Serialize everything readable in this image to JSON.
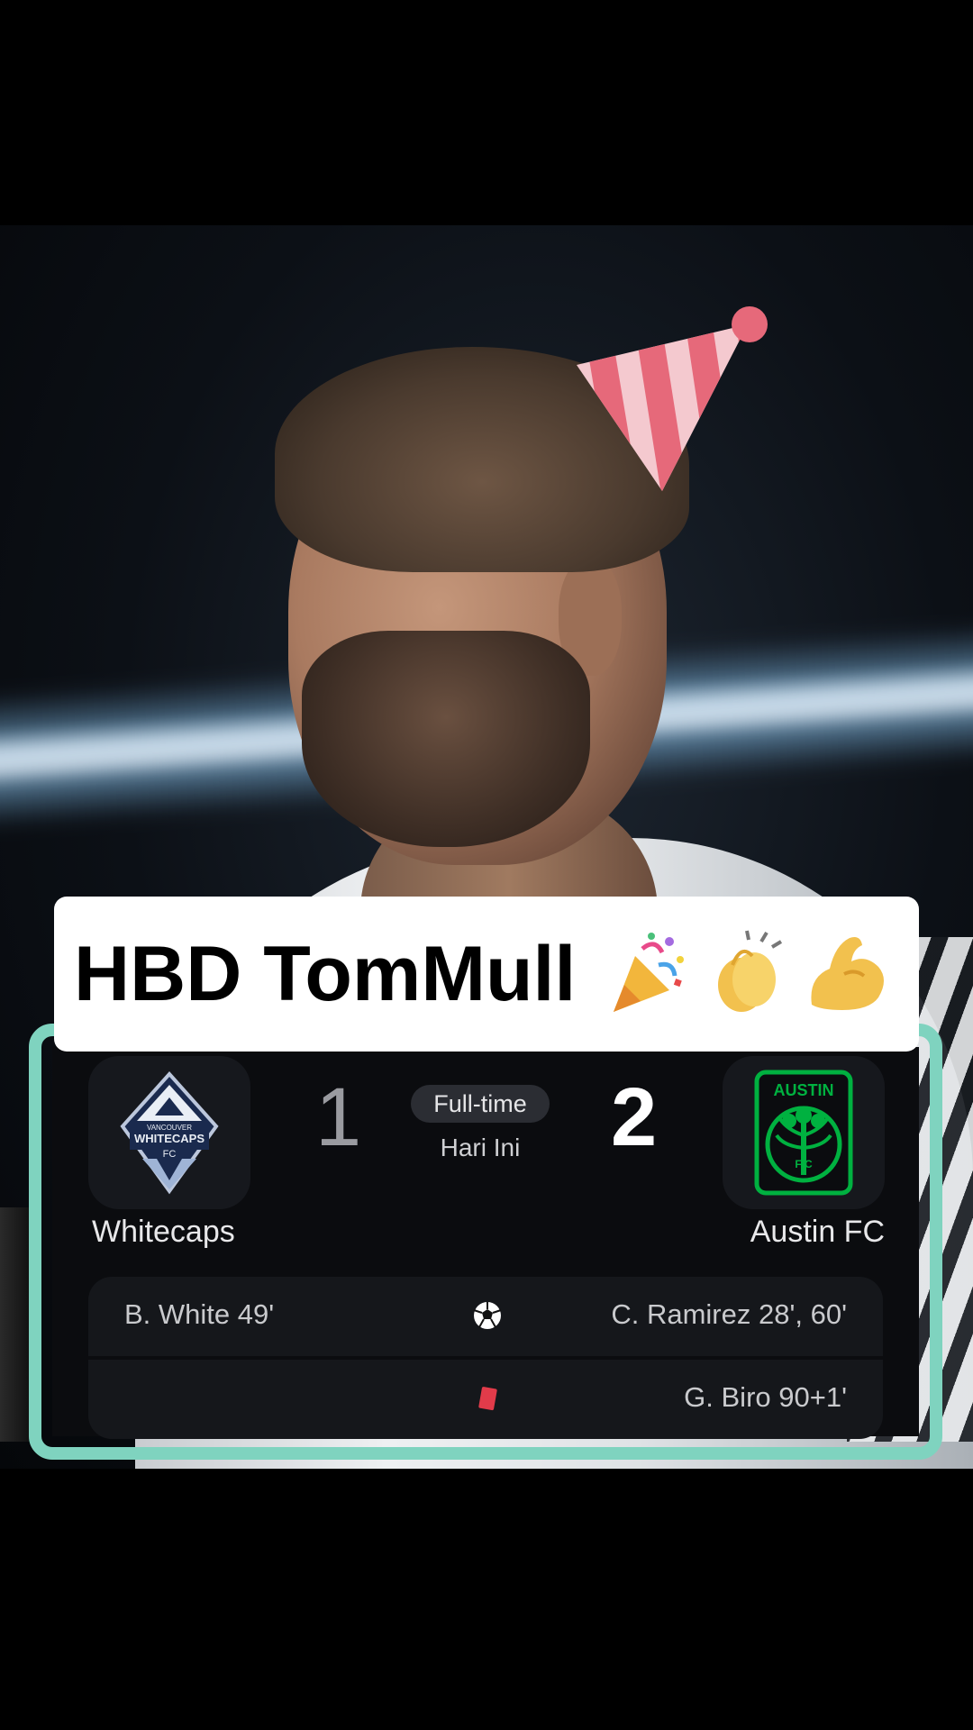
{
  "title": {
    "text": "HBD TomMull",
    "emojis": [
      "party-popper-icon",
      "clapping-hands-icon",
      "flexed-biceps-icon"
    ]
  },
  "match": {
    "home": {
      "name": "Whitecaps",
      "crest": "vancouver-whitecaps-crest",
      "crest_text_top": "VANCOUVER",
      "crest_text_mid": "WHITECAPS",
      "crest_text_bottom": "FC",
      "score": "1"
    },
    "away": {
      "name": "Austin FC",
      "crest": "austin-fc-crest",
      "crest_text": "AUSTIN",
      "crest_text_bottom": "F C",
      "score": "2"
    },
    "status": "Full-time",
    "date": "Hari Ini",
    "events": [
      {
        "home": "B. White 49'",
        "icon": "soccer-ball-icon",
        "away": "C. Ramirez 28', 60'"
      },
      {
        "home": "",
        "icon": "red-card-icon",
        "away": "G. Biro 90+1'"
      }
    ]
  },
  "colors": {
    "card_border": "#7fd3bf",
    "card_background": "#0b0c0f",
    "winning_score": "#ffffff",
    "losing_score": "#9a9ba0",
    "austin_green": "#00b140",
    "red_card": "#e23b4a",
    "party_hat_pink": "#e6697a"
  }
}
